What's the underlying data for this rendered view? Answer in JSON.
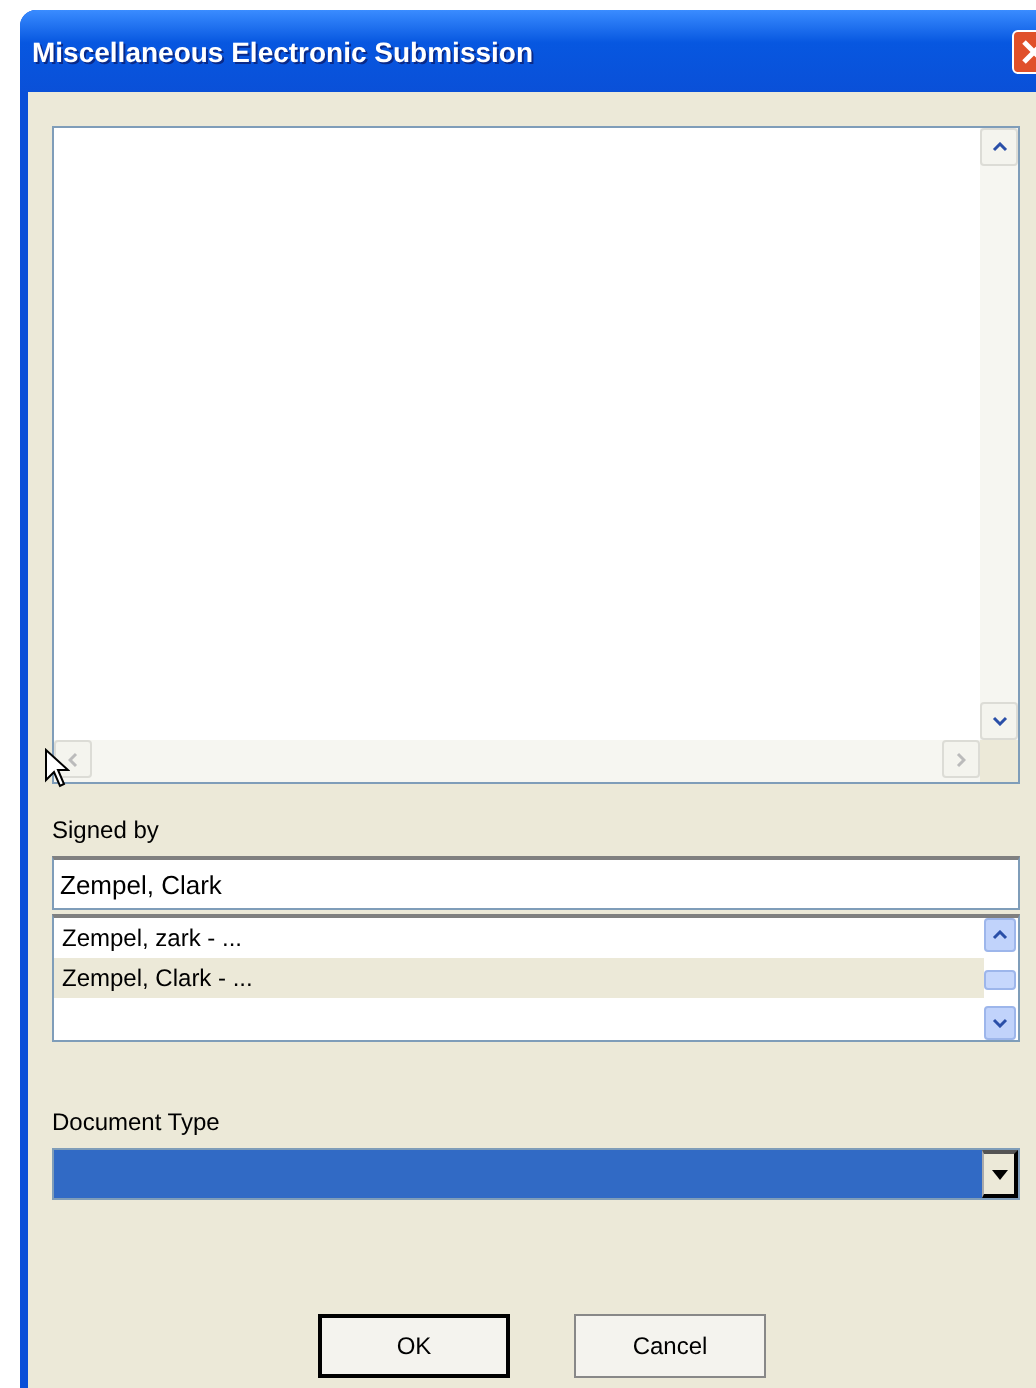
{
  "window": {
    "title": "Miscellaneous Electronic Submission"
  },
  "signed_by": {
    "label": "Signed by",
    "value": "Zempel, Clark",
    "options": [
      {
        "label": "Zempel, zark - ...",
        "selected": false
      },
      {
        "label": "Zempel, Clark - ...",
        "selected": true
      }
    ]
  },
  "document_type": {
    "label": "Document Type",
    "focused": true
  },
  "buttons": [
    {
      "label": "OK",
      "default": true
    },
    {
      "label": "Cancel",
      "default": false
    }
  ]
}
